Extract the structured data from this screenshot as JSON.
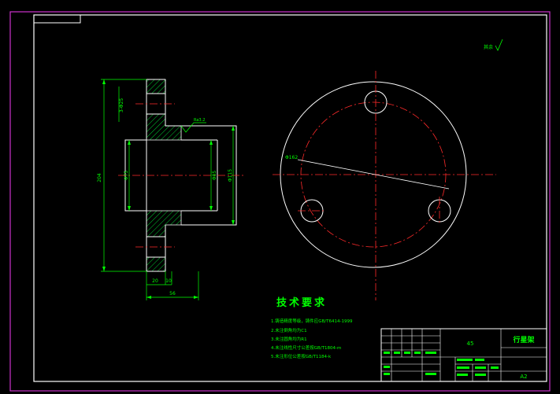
{
  "colors": {
    "background": "#000000",
    "outer_border": "#cc33cc",
    "frame": "#ffffff",
    "dimension": "#00ff00",
    "centerline": "#ff2a2a",
    "hatch": "#00cc33",
    "text": "#00ff00"
  },
  "drawing": {
    "roughness_note": "其余",
    "section_view": {
      "dim_total_height": "204",
      "dim_bolt_holes": "3-Φ25",
      "dim_bore": "Φ75",
      "dim_hub_left": "Φ85",
      "dim_hub_right": "Φ115",
      "dim_flange_thickness": "20",
      "dim_step": "10",
      "dim_total_length": "56",
      "roughness_value": "Ra3.2"
    },
    "top_view": {
      "dim_pitch_circle": "Φ162"
    }
  },
  "notes": {
    "heading": "技术要求",
    "items": [
      "1.铸造精度等级，铸件应GB/T6414-1999",
      "2.未注倒角均为C1",
      "3.未注圆角均为R1",
      "4.未注线性尺寸公差按GB/T1804-m",
      "5.未注形位公差按GB/T1184-k"
    ]
  },
  "title_block": {
    "material": "45",
    "part_name": "行星架",
    "scale": "A2"
  }
}
